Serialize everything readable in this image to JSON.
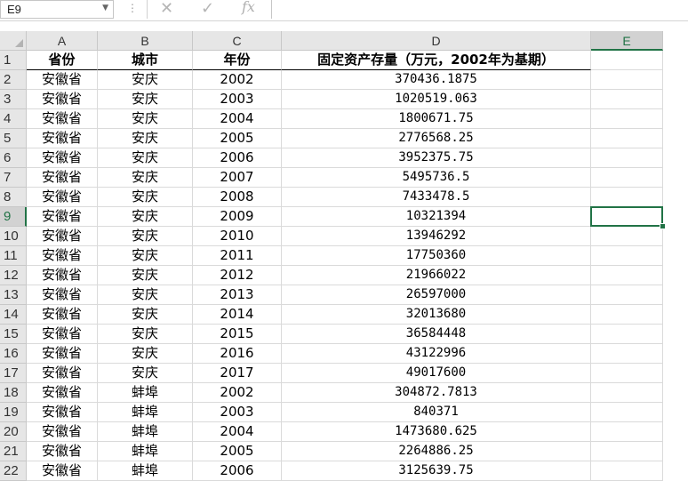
{
  "name_box": {
    "value": "E9"
  },
  "formula_bar": {
    "value": ""
  },
  "columns": [
    "A",
    "B",
    "C",
    "D",
    "E"
  ],
  "selected_column": "E",
  "selected_row": "9",
  "header_row": {
    "num": "1",
    "cells": [
      "省份",
      "城市",
      "年份",
      "固定资产存量（万元，2002年为基期）",
      ""
    ]
  },
  "rows": [
    {
      "num": "2",
      "cells": [
        "安徽省",
        "安庆",
        "2002",
        "370436.1875",
        ""
      ]
    },
    {
      "num": "3",
      "cells": [
        "安徽省",
        "安庆",
        "2003",
        "1020519.063",
        ""
      ]
    },
    {
      "num": "4",
      "cells": [
        "安徽省",
        "安庆",
        "2004",
        "1800671.75",
        ""
      ]
    },
    {
      "num": "5",
      "cells": [
        "安徽省",
        "安庆",
        "2005",
        "2776568.25",
        ""
      ]
    },
    {
      "num": "6",
      "cells": [
        "安徽省",
        "安庆",
        "2006",
        "3952375.75",
        ""
      ]
    },
    {
      "num": "7",
      "cells": [
        "安徽省",
        "安庆",
        "2007",
        "5495736.5",
        ""
      ]
    },
    {
      "num": "8",
      "cells": [
        "安徽省",
        "安庆",
        "2008",
        "7433478.5",
        ""
      ]
    },
    {
      "num": "9",
      "cells": [
        "安徽省",
        "安庆",
        "2009",
        "10321394",
        ""
      ]
    },
    {
      "num": "10",
      "cells": [
        "安徽省",
        "安庆",
        "2010",
        "13946292",
        ""
      ]
    },
    {
      "num": "11",
      "cells": [
        "安徽省",
        "安庆",
        "2011",
        "17750360",
        ""
      ]
    },
    {
      "num": "12",
      "cells": [
        "安徽省",
        "安庆",
        "2012",
        "21966022",
        ""
      ]
    },
    {
      "num": "13",
      "cells": [
        "安徽省",
        "安庆",
        "2013",
        "26597000",
        ""
      ]
    },
    {
      "num": "14",
      "cells": [
        "安徽省",
        "安庆",
        "2014",
        "32013680",
        ""
      ]
    },
    {
      "num": "15",
      "cells": [
        "安徽省",
        "安庆",
        "2015",
        "36584448",
        ""
      ]
    },
    {
      "num": "16",
      "cells": [
        "安徽省",
        "安庆",
        "2016",
        "43122996",
        ""
      ]
    },
    {
      "num": "17",
      "cells": [
        "安徽省",
        "安庆",
        "2017",
        "49017600",
        ""
      ]
    },
    {
      "num": "18",
      "cells": [
        "安徽省",
        "蚌埠",
        "2002",
        "304872.7813",
        ""
      ]
    },
    {
      "num": "19",
      "cells": [
        "安徽省",
        "蚌埠",
        "2003",
        "840371",
        ""
      ]
    },
    {
      "num": "20",
      "cells": [
        "安徽省",
        "蚌埠",
        "2004",
        "1473680.625",
        ""
      ]
    },
    {
      "num": "21",
      "cells": [
        "安徽省",
        "蚌埠",
        "2005",
        "2264886.25",
        ""
      ]
    },
    {
      "num": "22",
      "cells": [
        "安徽省",
        "蚌埠",
        "2006",
        "3125639.75",
        ""
      ]
    }
  ],
  "accent_color": "#217346"
}
